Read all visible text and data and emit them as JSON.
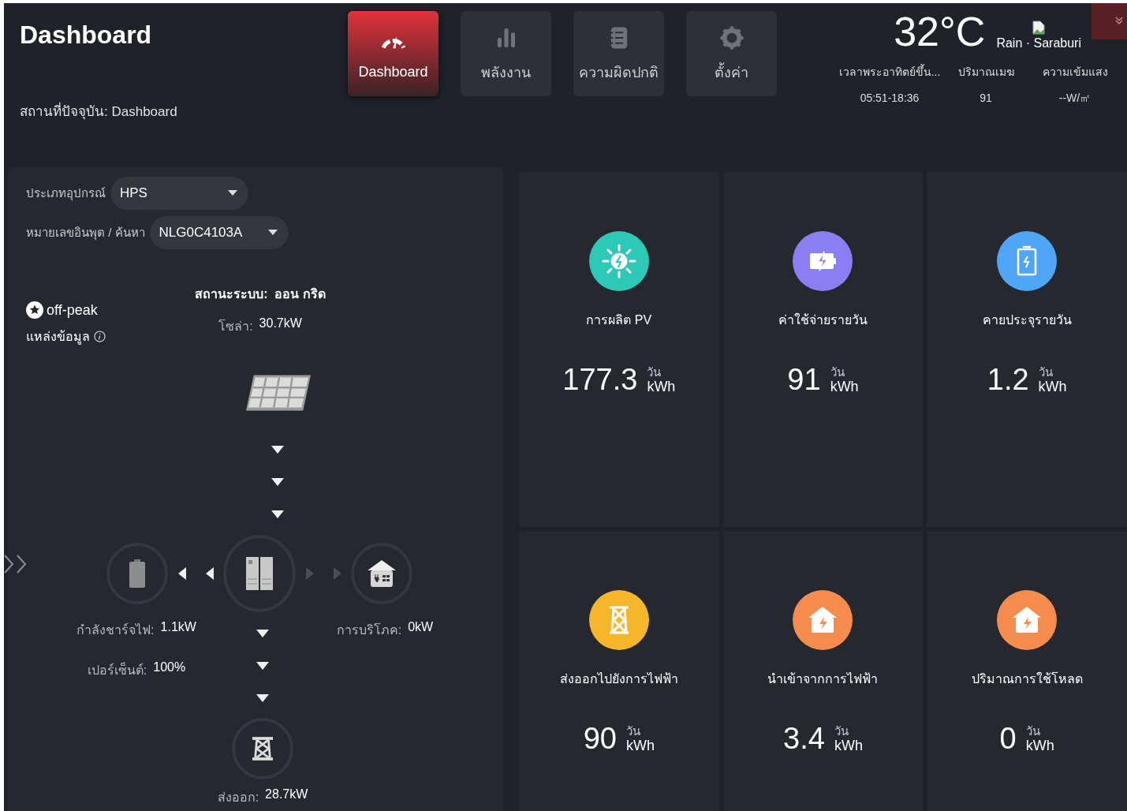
{
  "header": {
    "title": "Dashboard",
    "breadcrumb": "สถานที่ปัจจุบัน: Dashboard"
  },
  "nav": [
    {
      "label": "Dashboard",
      "kind": "gauge",
      "selected": true
    },
    {
      "label": "พลังงาน",
      "kind": "bars",
      "selected": false
    },
    {
      "label": "ความผิดปกติ",
      "kind": "notebook",
      "selected": false
    },
    {
      "label": "ตั้งค่า",
      "kind": "gear",
      "selected": false
    }
  ],
  "weather": {
    "temperature": "32°C",
    "condition": "Rain · Saraburi",
    "stats": [
      {
        "label": "เวลาพระอาทิตย์ขึ้น...",
        "value": "05:51-18:36"
      },
      {
        "label": "ปริมาณเมฆ",
        "value": "91"
      },
      {
        "label": "ความเข้มแสง",
        "value": "--W/㎡"
      }
    ]
  },
  "filters": [
    {
      "label": "ประเภทอุปกรณ์",
      "value": "HPS"
    },
    {
      "label": "หมายเลขอินพุต / ค้นหา",
      "value": "NLG0C4103A"
    }
  ],
  "tariff": "off-peak",
  "data_source": "แหล่งข้อมูล",
  "flow": {
    "status": {
      "label": "สถานะระบบ:",
      "value": "ออน กริด"
    },
    "solar": {
      "label": "โซล่า:",
      "value": "30.7kW",
      "active": true
    },
    "battery": {
      "active": true,
      "readings": [
        {
          "label": "กำลังชาร์จไฟ:",
          "value": "1.1kW"
        },
        {
          "label": "เปอร์เซ็นต์:",
          "value": "100%"
        }
      ]
    },
    "load": {
      "label": "การบริโภค:",
      "value": "0kW",
      "active": false
    },
    "grid": {
      "label": "ส่งออก:",
      "value": "28.7kW",
      "active": true
    }
  },
  "cards": [
    {
      "label": "การผลิต PV",
      "value": "177.3",
      "period": "วัน",
      "unit": "kWh",
      "kind": "sun",
      "color": "#2ec8b6"
    },
    {
      "label": "ค่าใช้จ่ายรายวัน",
      "value": "91",
      "period": "วัน",
      "unit": "kWh",
      "kind": "charge",
      "color": "#8b7ef2"
    },
    {
      "label": "คายประจุรายวัน",
      "value": "1.2",
      "period": "วัน",
      "unit": "kWh",
      "kind": "battery",
      "color": "#4fa6f6"
    },
    {
      "label": "ส่งออกไปยังการไฟฟ้า",
      "value": "90",
      "period": "วัน",
      "unit": "kWh",
      "kind": "tower",
      "color": "#f6b62c"
    },
    {
      "label": "นำเข้าจากการไฟฟ้า",
      "value": "3.4",
      "period": "วัน",
      "unit": "kWh",
      "kind": "house",
      "color": "#f58b4c"
    },
    {
      "label": "ปริมาณการใช้โหลด",
      "value": "0",
      "period": "วัน",
      "unit": "kWh",
      "kind": "house",
      "color": "#f58b4c"
    }
  ]
}
